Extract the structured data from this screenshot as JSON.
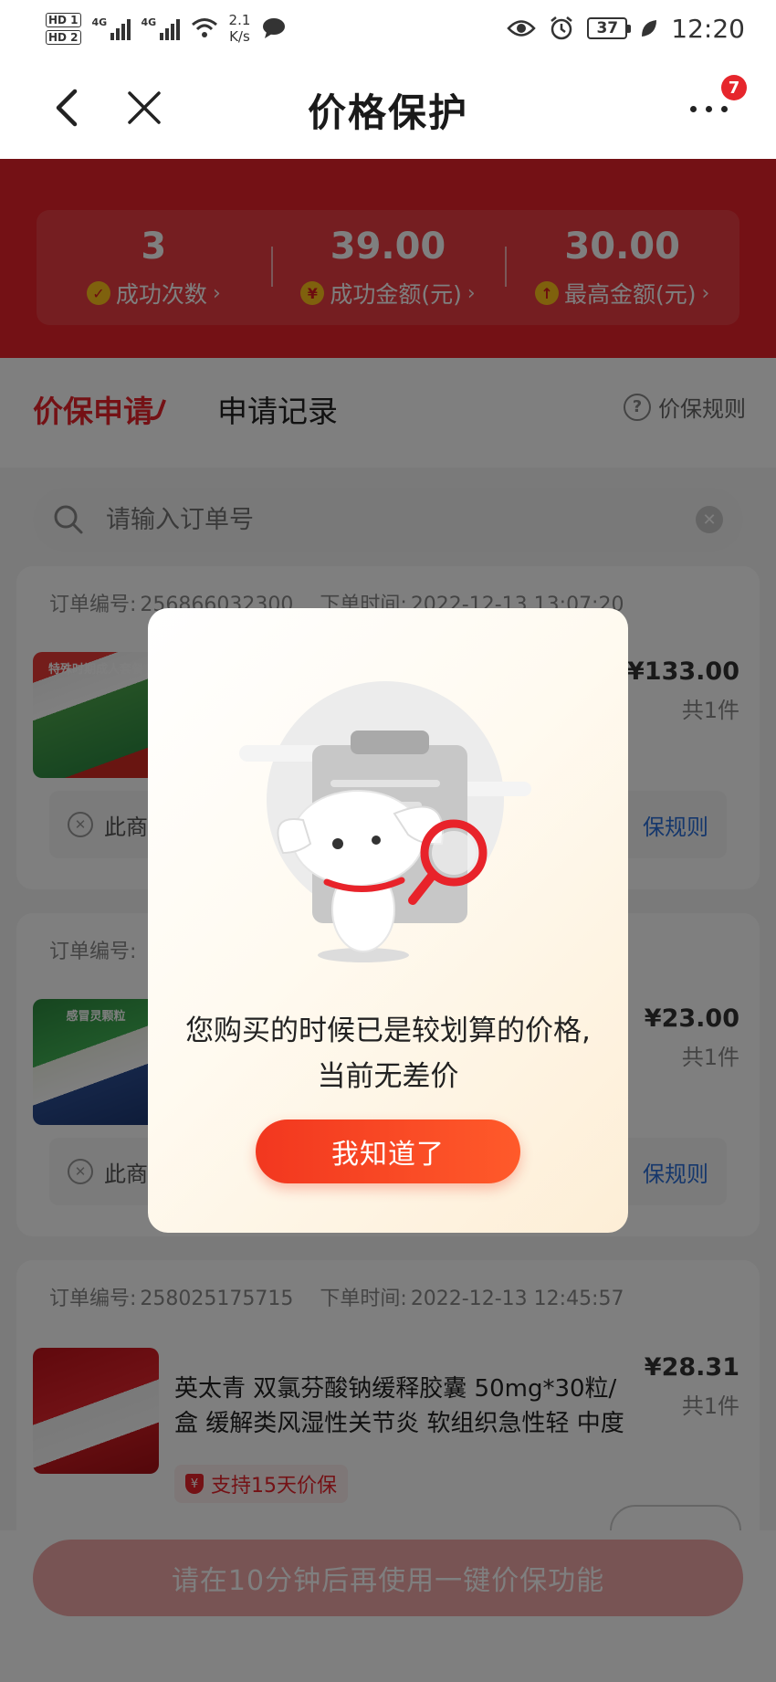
{
  "status_bar": {
    "hd1": "HD 1",
    "hd2": "HD 2",
    "network1": "4G",
    "network2": "4G",
    "speed_value": "2.1",
    "speed_unit": "K/s",
    "battery": "37",
    "time": "12:20"
  },
  "nav": {
    "title": "价格保护",
    "badge_count": "7"
  },
  "stats": [
    {
      "value": "3",
      "label": "成功次数",
      "icon": "check-icon"
    },
    {
      "value": "39.00",
      "label": "成功金额(元)",
      "icon": "yen-icon"
    },
    {
      "value": "30.00",
      "label": "最高金额(元)",
      "icon": "arrow-up-icon"
    }
  ],
  "tabs": {
    "active": "价保申请",
    "other": "申请记录",
    "rules": "价保规则"
  },
  "search": {
    "placeholder": "请输入订单号"
  },
  "orders": [
    {
      "order_label": "订单编号:",
      "order_no": "256866032300",
      "time_label": "下单时间:",
      "order_time": "2022-12-13 13:07:20",
      "thumb_caption": "特殊时期成人套餐",
      "price": "¥133.00",
      "qty": "共1件",
      "notice": "此商品",
      "notice_link": "保规则"
    },
    {
      "order_label": "订单编号:",
      "thumb_caption": "感冒灵颗粒",
      "price": "¥23.00",
      "qty": "共1件",
      "notice": "此商品",
      "notice_link": "保规则"
    },
    {
      "order_label": "订单编号:",
      "order_no": "258025175715",
      "time_label": "下单时间:",
      "order_time": "2022-12-13 12:45:57",
      "name": "英太青 双氯芬酸钠缓释胶囊 50mg*30粒/盒 缓解类风湿性关节炎 软组织急性轻 中度",
      "price": "¥28.31",
      "qty": "共1件",
      "guarantee": "支持15天价保"
    }
  ],
  "bottom_button": "请在10分钟后再使用一键价保功能",
  "dialog": {
    "message_line1": "您购买的时候已是较划算的价格,",
    "message_line2": "当前无差价",
    "button": "我知道了"
  },
  "colors": {
    "brand_red": "#e8232a",
    "link_blue": "#2a6fd8",
    "dialog_button": "#f2371f"
  }
}
